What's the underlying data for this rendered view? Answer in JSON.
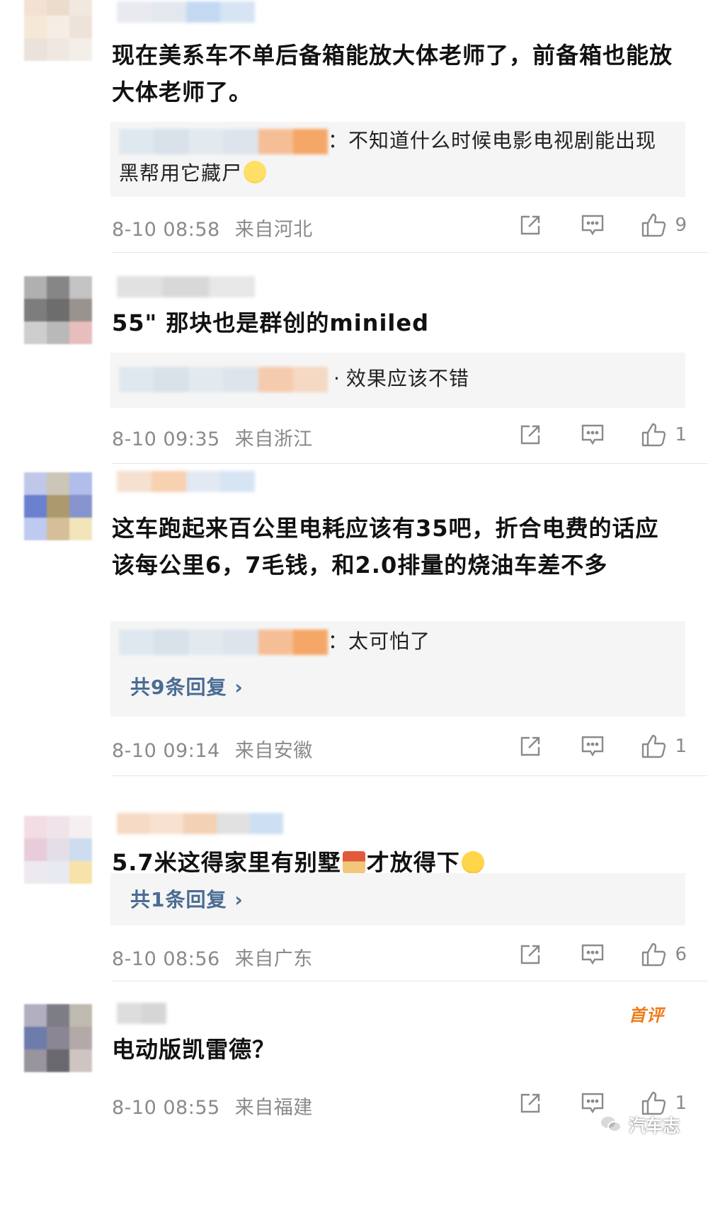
{
  "colors": {
    "link_blue": "#4a6c93",
    "meta_gray": "#8a8a8a",
    "reply_bg": "#f5f5f5",
    "first_badge": "#f07c1b"
  },
  "comments": [
    {
      "text": "现在美系车不单后备箱能放大体老师了，前备箱也能放大体老师了。",
      "reply": {
        "separator": "：",
        "text": "不知道什么时候电影电视剧能出现黑帮用它藏尸",
        "emoji": "laughing-face-emoji"
      },
      "time": "8-10 08:58",
      "location": "来自河北",
      "likes": "9"
    },
    {
      "text": "55\" 那块也是群创的miniled",
      "reply": {
        "separator": "·",
        "text": "效果应该不错"
      },
      "time": "8-10 09:35",
      "location": "来自浙江",
      "likes": "1"
    },
    {
      "text": "这车跑起来百公里电耗应该有35吧，折合电费的话应该每公里6，7毛钱，和2.0排量的烧油车差不多",
      "reply": {
        "separator": "：",
        "text": "太可怕了"
      },
      "more_replies": "共9条回复 ›",
      "time": "8-10 09:14",
      "location": "来自安徽",
      "likes": "1"
    },
    {
      "text_before": "5.7米这得家里有别墅",
      "emoji1": "house-emoji",
      "text_after": "才放得下",
      "emoji2": "face-with-hearts-emoji",
      "more_replies": "共1条回复 ›",
      "time": "8-10 08:56",
      "location": "来自广东",
      "likes": "6"
    },
    {
      "badge": "首评",
      "text": "电动版凯雷德？",
      "time": "8-10 08:55",
      "location": "来自福建",
      "likes": "1"
    }
  ],
  "watermark": "汽车志"
}
